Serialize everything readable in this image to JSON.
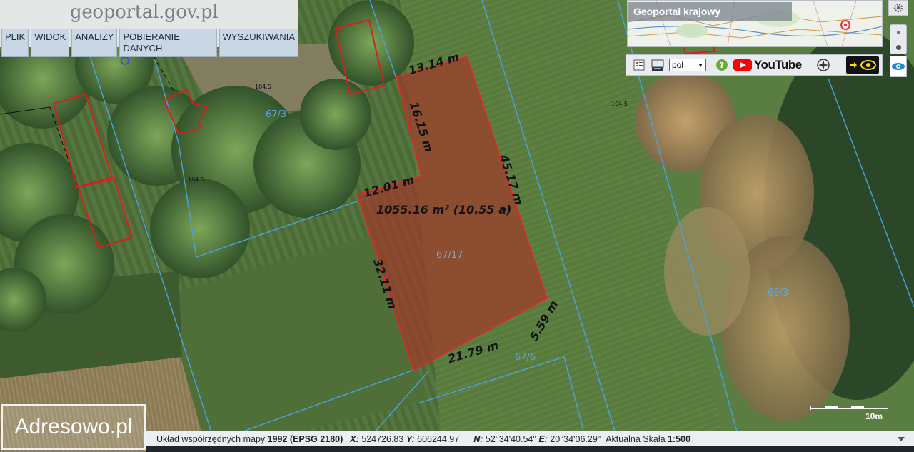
{
  "app": {
    "logo_text": "geoportal.gov.pl",
    "menu": [
      "PLIK",
      "WIDOK",
      "ANALIZY",
      "POBIERANIE DANYCH",
      "WYSZUKIWANIA"
    ]
  },
  "overview": {
    "title": "Geoportal krajowy"
  },
  "toolbar": {
    "language": "pol",
    "youtube_label": "YouTube",
    "icons": [
      "legend-icon",
      "wms-layers-icon",
      "help-icon",
      "youtube-icon",
      "compass-icon",
      "arrow-icon",
      "eye-icon"
    ]
  },
  "measurements": {
    "area": "1055.16 m² (10.55 a)",
    "edges": [
      "13.14 m",
      "16.15 m",
      "12.01 m",
      "45.17 m",
      "32.11 m",
      "5.59 m",
      "21.79 m"
    ]
  },
  "parcels": [
    "67/3",
    "67/17",
    "67/6",
    "68/3"
  ],
  "elevations": [
    "104.5",
    "104.5",
    "104.5"
  ],
  "scale": {
    "label": "10m"
  },
  "watermark": "Adresowo.pl",
  "status": {
    "crs_prefix": "Układ współrzędnych mapy",
    "crs_value": "1992 (EPSG 2180)",
    "x_label": "X:",
    "x_value": "524726.83",
    "y_label": "Y:",
    "y_value": "606244.97",
    "n_label": "N:",
    "n_value": "52°34'40.54\"",
    "e_label": "E:",
    "e_value": "20°34'06.29\"",
    "scale_prefix": "Aktualna Skala",
    "scale_value": "1:500"
  },
  "colors": {
    "parcel_highlight": "#a03a2a",
    "parcel_outline": "#e8252a",
    "cadastral_lines": "#4aa3e0",
    "building_outline": "#d81e1e"
  }
}
